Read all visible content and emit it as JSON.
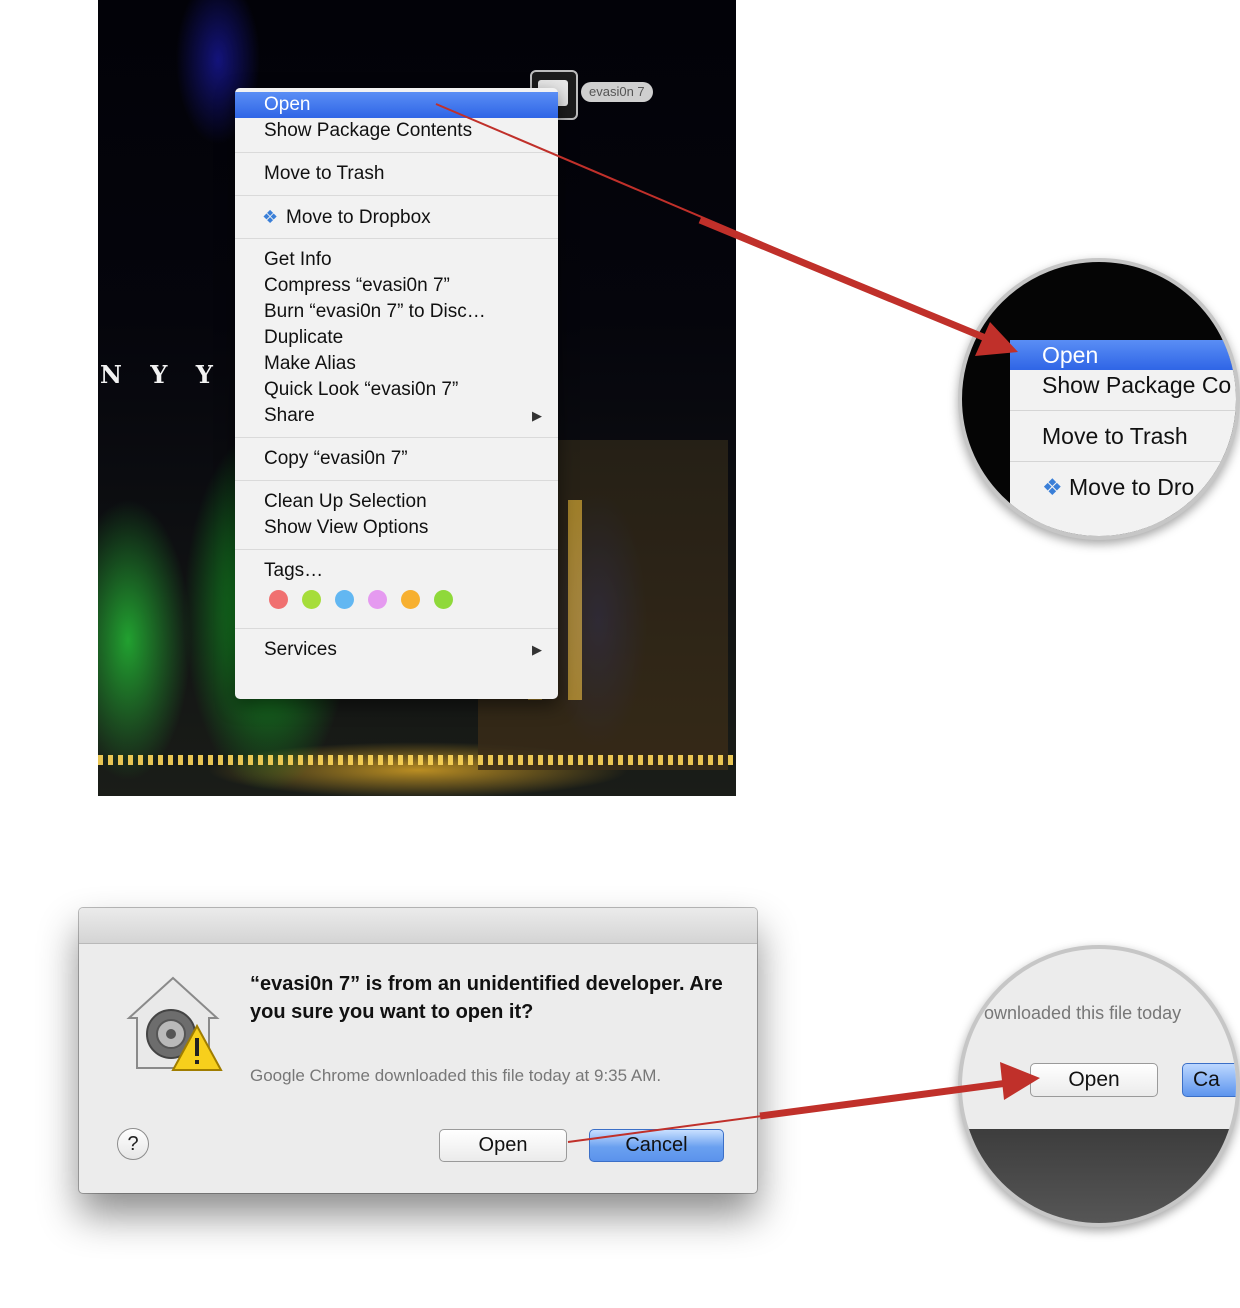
{
  "desktop": {
    "file_label": "evasi0n 7",
    "sign_text": "N Y Y I"
  },
  "context_menu": {
    "items": [
      {
        "label": "Open"
      },
      {
        "label": "Show Package Contents"
      },
      {
        "label": "Move to Trash"
      },
      {
        "label": "Move to Dropbox"
      },
      {
        "label": "Get Info"
      },
      {
        "label": "Compress “evasi0n 7”"
      },
      {
        "label": "Burn “evasi0n 7” to Disc…"
      },
      {
        "label": "Duplicate"
      },
      {
        "label": "Make Alias"
      },
      {
        "label": "Quick Look “evasi0n 7”"
      },
      {
        "label": "Share"
      },
      {
        "label": "Copy “evasi0n 7”"
      },
      {
        "label": "Clean Up Selection"
      },
      {
        "label": "Show View Options"
      },
      {
        "label": "Tags…"
      },
      {
        "label": "Services"
      }
    ],
    "submenu_arrow": "▶",
    "tag_colors": [
      "#f07070",
      "#a6dd3a",
      "#62b7f2",
      "#e59af0",
      "#f7b030",
      "#8fd93a"
    ]
  },
  "zoom_top": {
    "items": [
      "Open",
      "Show Package Co",
      "Move to Trash",
      "Move to Dro"
    ]
  },
  "zoom_bottom": {
    "text": "ownloaded this file today",
    "open_label": "Open",
    "cancel_label": "Ca"
  },
  "dialog": {
    "heading": "“evasi0n 7” is from an unidentified developer. Are you sure you want to open it?",
    "subtext": "Google Chrome downloaded this file today at 9:35 AM.",
    "help_label": "?",
    "open_label": "Open",
    "cancel_label": "Cancel"
  },
  "colors": {
    "highlight": "#2f65e6",
    "arrow": "#c0302a",
    "default_button": "#5b93ec"
  }
}
